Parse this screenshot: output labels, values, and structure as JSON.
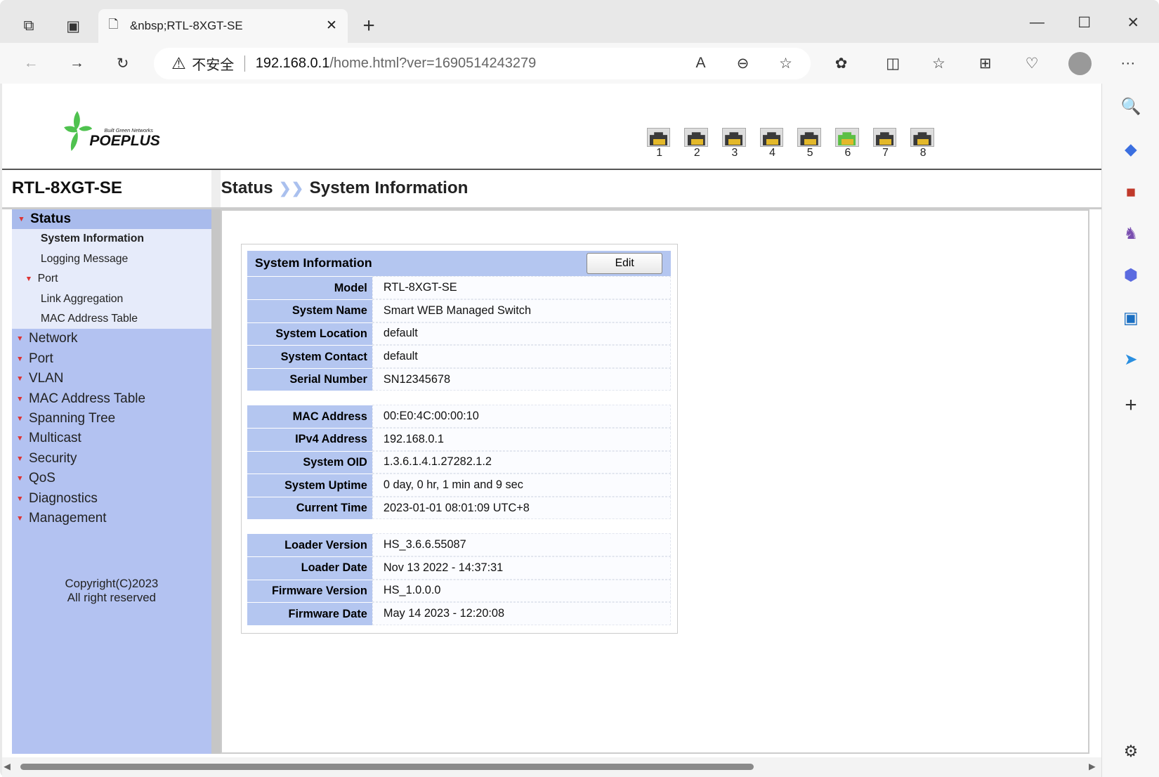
{
  "browser": {
    "tab_title": "&nbsp;RTL-8XGT-SE",
    "security_label": "不安全",
    "url_host": "192.168.0.1",
    "url_path": "/home.html?ver=1690514243279"
  },
  "header": {
    "logo_tagline": "Built Green Networks",
    "logo_text": "POEPLUS",
    "ports": [
      {
        "label": "1",
        "status": "down"
      },
      {
        "label": "2",
        "status": "down"
      },
      {
        "label": "3",
        "status": "down"
      },
      {
        "label": "4",
        "status": "down"
      },
      {
        "label": "5",
        "status": "down"
      },
      {
        "label": "6",
        "status": "up"
      },
      {
        "label": "7",
        "status": "down"
      },
      {
        "label": "8",
        "status": "down"
      }
    ],
    "port_colors": {
      "up": "#5cbf45",
      "down": "#3a3a3a"
    }
  },
  "device_name": "RTL-8XGT-SE",
  "breadcrumb": {
    "section": "Status",
    "page": "System Information"
  },
  "sidebar": {
    "active": "Status",
    "submenu": [
      "System Information",
      "Logging Message",
      "Port",
      "Link Aggregation",
      "MAC Address Table"
    ],
    "items": [
      "Network",
      "Port",
      "VLAN",
      "MAC Address Table",
      "Spanning Tree",
      "Multicast",
      "Security",
      "QoS",
      "Diagnostics",
      "Management"
    ],
    "copyright_line1": "Copyright(C)2023",
    "copyright_line2": "All right reserved"
  },
  "panel": {
    "title": "System Information",
    "edit_label": "Edit",
    "groups": [
      [
        {
          "label": "Model",
          "value": "RTL-8XGT-SE"
        },
        {
          "label": "System Name",
          "value": "Smart WEB Managed Switch"
        },
        {
          "label": "System Location",
          "value": "default"
        },
        {
          "label": "System Contact",
          "value": "default"
        },
        {
          "label": "Serial Number",
          "value": "SN12345678"
        }
      ],
      [
        {
          "label": "MAC Address",
          "value": "00:E0:4C:00:00:10"
        },
        {
          "label": "IPv4 Address",
          "value": "192.168.0.1"
        },
        {
          "label": "System OID",
          "value": "1.3.6.1.4.1.27282.1.2"
        },
        {
          "label": "System Uptime",
          "value": "0 day, 0 hr, 1 min and 9 sec"
        },
        {
          "label": "Current Time",
          "value": "2023-01-01 08:01:09 UTC+8"
        }
      ],
      [
        {
          "label": "Loader Version",
          "value": "HS_3.6.6.55087"
        },
        {
          "label": "Loader Date",
          "value": "Nov 13 2022 - 14:37:31"
        },
        {
          "label": "Firmware Version",
          "value": "HS_1.0.0.0"
        },
        {
          "label": "Firmware Date",
          "value": "May 14 2023 - 12:20:08"
        }
      ]
    ]
  }
}
